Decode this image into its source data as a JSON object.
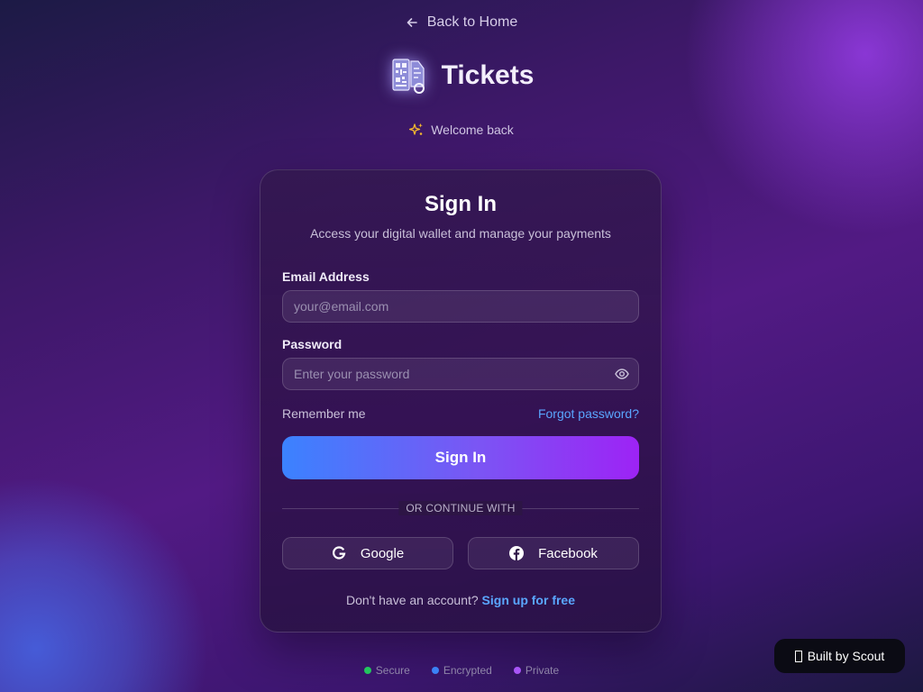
{
  "nav": {
    "back_label": "Back to Home"
  },
  "brand": {
    "name": "Tickets",
    "logo_icon": "ticket-qr-icon"
  },
  "welcome": {
    "text": "Welcome back",
    "icon": "sparkles-icon"
  },
  "card": {
    "title": "Sign In",
    "subtitle": "Access your digital wallet and manage your payments"
  },
  "form": {
    "email_label": "Email Address",
    "email_placeholder": "your@email.com",
    "email_value": "",
    "password_label": "Password",
    "password_placeholder": "Enter your password",
    "password_value": "",
    "password_toggle_icon": "eye-icon",
    "remember_label": "Remember me",
    "forgot_label": "Forgot password?",
    "submit_label": "Sign In"
  },
  "social": {
    "divider_text": "OR CONTINUE WITH",
    "google_label": "Google",
    "facebook_label": "Facebook"
  },
  "signup": {
    "prompt": "Don't have an account?",
    "link_label": "Sign up for free"
  },
  "badges": [
    {
      "label": "Secure",
      "color": "#22c55e"
    },
    {
      "label": "Encrypted",
      "color": "#3b82f6"
    },
    {
      "label": "Private",
      "color": "#a855f7"
    }
  ],
  "built_by": {
    "label": "Built by Scout"
  },
  "colors": {
    "accent_link": "#5aa6ff",
    "button_gradient_start": "#3b82ff",
    "button_gradient_end": "#9d23f5"
  }
}
